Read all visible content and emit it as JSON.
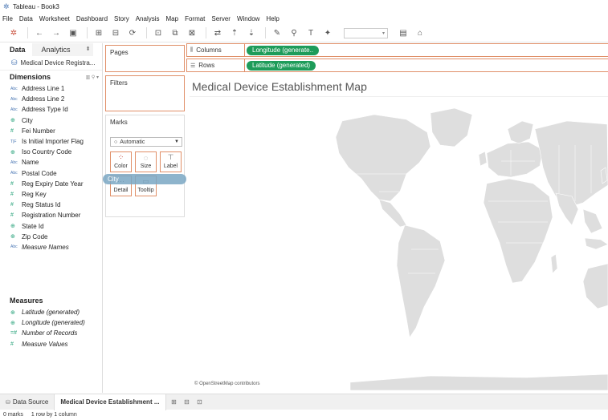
{
  "window": {
    "title": "Tableau - Book3",
    "app_icon": "tableau-logo-icon"
  },
  "menu": [
    "File",
    "Data",
    "Worksheet",
    "Dashboard",
    "Story",
    "Analysis",
    "Map",
    "Format",
    "Server",
    "Window",
    "Help"
  ],
  "toolbar": {
    "icons": [
      "tableau-logo-icon",
      "undo-icon",
      "redo-icon",
      "save-icon",
      "add-datasource-icon",
      "pause-updates-icon",
      "refresh-icon",
      "new-worksheet-icon",
      "duplicate-sheet-icon",
      "clear-sheet-icon",
      "swap-icon",
      "sort-ascending-icon",
      "sort-descending-icon",
      "highlight-icon",
      "group-icon",
      "labels-icon",
      "pin-icon",
      "fit-dropdown",
      "show-cards-icon",
      "presentation-icon"
    ]
  },
  "datapane": {
    "tab_data": "Data",
    "tab_analytics": "Analytics",
    "datasource": "Medical Device Registra...",
    "dimensions_header": "Dimensions",
    "dimensions": [
      {
        "label": "Address Line 1",
        "type": "Abc"
      },
      {
        "label": "Address Line 2",
        "type": "Abc"
      },
      {
        "label": "Address Type Id",
        "type": "Abc"
      },
      {
        "label": "City",
        "type": "geo"
      },
      {
        "label": "Fei Number",
        "type": "#"
      },
      {
        "label": "Is Initial Importer Flag",
        "type": "T|F"
      },
      {
        "label": "Iso Country Code",
        "type": "geo"
      },
      {
        "label": "Name",
        "type": "Abc"
      },
      {
        "label": "Postal Code",
        "type": "Abc"
      },
      {
        "label": "Reg Expiry Date Year",
        "type": "#"
      },
      {
        "label": "Reg Key",
        "type": "#"
      },
      {
        "label": "Reg Status Id",
        "type": "#"
      },
      {
        "label": "Registration Number",
        "type": "#"
      },
      {
        "label": "State Id",
        "type": "geo"
      },
      {
        "label": "Zip Code",
        "type": "geo"
      },
      {
        "label": "Measure Names",
        "type": "Abc"
      }
    ],
    "measures_header": "Measures",
    "measures": [
      {
        "label": "Latitude (generated)",
        "type": "geo"
      },
      {
        "label": "Longitude (generated)",
        "type": "geo"
      },
      {
        "label": "Number of Records",
        "type": "=#"
      },
      {
        "label": "Measure Values",
        "type": "#"
      }
    ]
  },
  "cards": {
    "pages": "Pages",
    "filters": "Filters",
    "marks": "Marks",
    "mark_type": "Automatic",
    "buttons": [
      "Color",
      "Size",
      "Label",
      "Detail",
      "Tooltip"
    ],
    "drag_pill": "City"
  },
  "shelves": {
    "columns_label": "Columns",
    "columns_pill": "Longitude (generate..",
    "rows_label": "Rows",
    "rows_pill": "Latitude (generated)"
  },
  "view": {
    "title": "Medical Device Establishment Map",
    "attribution": "© OpenStreetMap contributors"
  },
  "tabs": {
    "datasource": "Data Source",
    "sheet": "Medical Device Establishment ...",
    "actions": [
      "new-worksheet-icon",
      "new-dashboard-icon",
      "new-story-icon"
    ]
  },
  "status": {
    "marks": "0 marks",
    "rows_cols": "1 row by 1 column"
  },
  "colors": {
    "pill_green": "#1e9c5a",
    "shelf_border": "#e08f68",
    "land": "#dedede"
  }
}
